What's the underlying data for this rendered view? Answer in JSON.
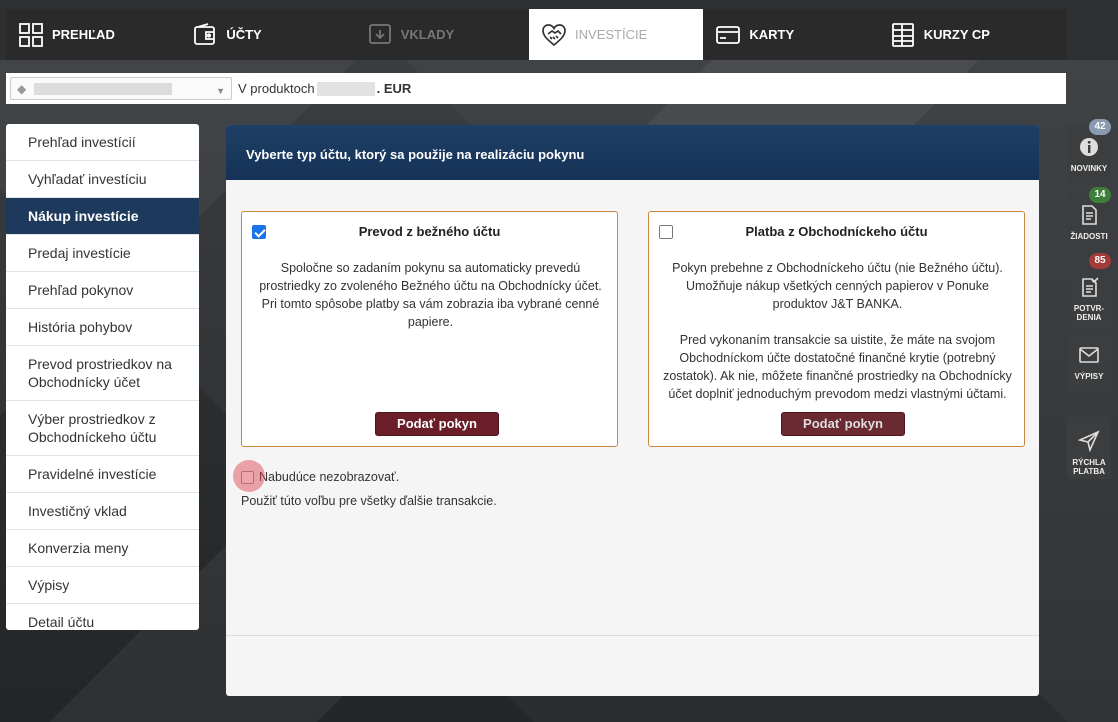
{
  "nav": {
    "items": [
      {
        "label": "PREHĽAD",
        "icon": "grid-icon"
      },
      {
        "label": "ÚČTY",
        "icon": "wallet-icon"
      },
      {
        "label": "VKLADY",
        "icon": "deposit-icon"
      },
      {
        "label": "INVESTÍCIE",
        "icon": "handshake-icon"
      },
      {
        "label": "KARTY",
        "icon": "card-icon"
      },
      {
        "label": "KURZY CP",
        "icon": "table-icon"
      }
    ]
  },
  "product_bar": {
    "prefix": "V produktoch",
    "currency": ". EUR",
    "selector_icon": "diamond-icon"
  },
  "sidebar": {
    "items": [
      {
        "label": "Prehľad investícií"
      },
      {
        "label": "Vyhľadať investíciu"
      },
      {
        "label": "Nákup investície"
      },
      {
        "label": "Predaj investície"
      },
      {
        "label": "Prehľad pokynov"
      },
      {
        "label": "História pohybov"
      },
      {
        "label": "Prevod prostriedkov na Obchodnícky účet"
      },
      {
        "label": "Výber prostriedkov z Obchodníckeho účtu"
      },
      {
        "label": "Pravidelné investície"
      },
      {
        "label": "Investičný vklad"
      },
      {
        "label": "Konverzia meny"
      },
      {
        "label": "Výpisy"
      },
      {
        "label": "Detail účtu"
      }
    ]
  },
  "main": {
    "heading": "Vyberte typ účtu, ktorý sa použije na realizáciu pokynu",
    "cards": [
      {
        "title": "Prevod z bežného účtu",
        "desc1": "Spoločne so zadaním pokynu sa automaticky prevedú prostriedky zo zvoleného Bežného účtu na Obchodnícky účet. Pri tomto spôsobe platby sa vám zobrazia iba vybrané cenné papiere.",
        "desc2": "",
        "button": "Podať pokyn"
      },
      {
        "title": "Platba z Obchodníckeho účtu",
        "desc1": "Pokyn prebehne z Obchodníckeho účtu (nie Bežného účtu). Umožňuje nákup všetkých cenných papierov v Ponuke produktov J&T BANKA.",
        "desc2": "Pred vykonaním transakcie sa uistite, že máte na svojom Obchodníckom účte dostatočné finančné krytie (potrebný zostatok). Ak nie, môžete finančné prostriedky na Obchodnícky účet doplniť jednoduchým prevodom medzi vlastnými účtami.",
        "button": "Podať pokyn"
      }
    ],
    "dont_show_label": "Nabudúce nezobrazovať.",
    "hint": "Použiť túto voľbu pre všetky ďalšie transakcie."
  },
  "rail": {
    "items": [
      {
        "label": "NOVINKY",
        "badge": "42",
        "badge_color": "#8a9bb0",
        "icon": "info-icon"
      },
      {
        "label": "ŽIADOSTI",
        "badge": "14",
        "badge_color": "#3f7d3a",
        "icon": "document-icon"
      },
      {
        "label": "POTVR-\nDENIA",
        "badge": "85",
        "badge_color": "#a33b3b",
        "icon": "confirm-document-icon"
      },
      {
        "label": "VÝPISY",
        "badge": "",
        "badge_color": "",
        "icon": "envelope-icon"
      },
      {
        "label": "RÝCHLA\nPLATBA",
        "badge": "",
        "badge_color": "",
        "icon": "send-icon"
      }
    ]
  }
}
